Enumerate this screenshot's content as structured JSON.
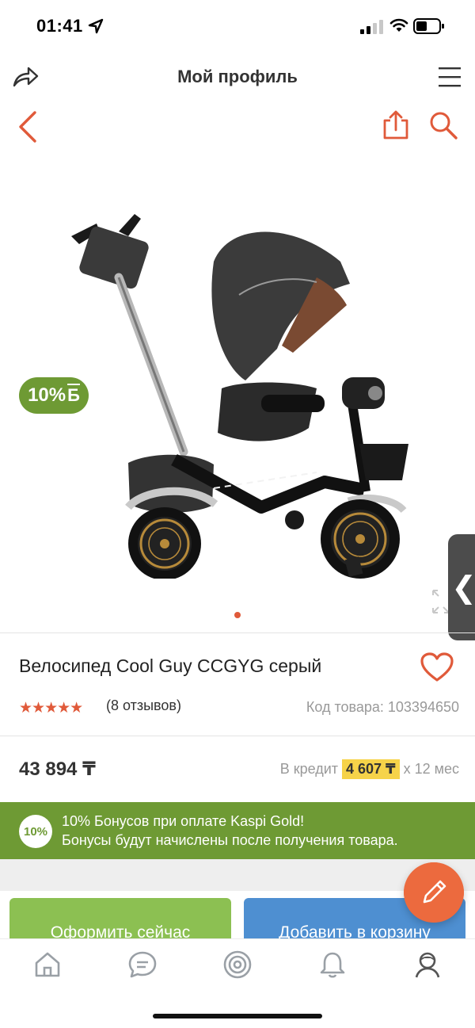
{
  "status_bar": {
    "time": "01:41"
  },
  "top_nav": {
    "title": "Мой профиль"
  },
  "gallery": {
    "bonus_badge_pct": "10%",
    "bonus_badge_symbol": "Б",
    "image_count_active": 1,
    "side_tab_glyph": "❮"
  },
  "product": {
    "title": "Велосипед Cool Guy CCGYG серый",
    "rating_stars": "★★★★★",
    "rating_value": 5,
    "reviews": "(8 отзывов)",
    "sku": "Код товара: 103394650",
    "price": "43 894 ₸",
    "credit_prefix": "В кредит",
    "credit_amount": "4 607 ₸",
    "credit_suffix": "х 12 мес"
  },
  "bonus_banner": {
    "badge": "10%",
    "line1": "10% Бонусов при оплате Kaspi Gold!",
    "line2": "Бонусы будут начислены после получения товара."
  },
  "actions": {
    "order_label": "Оформить сейчас",
    "cart_label": "Добавить в корзину"
  },
  "tab_bar": {
    "items": [
      "home-icon",
      "chat-icon",
      "target-icon",
      "bell-icon",
      "profile-icon"
    ],
    "active": "profile-icon"
  },
  "colors": {
    "accent": "#e05a3a",
    "bonus_green": "#6e9a34",
    "order_green": "#8cc052",
    "cart_blue": "#4e8fd1",
    "credit_yellow": "#f6d349",
    "fab_orange": "#ec6a3e"
  }
}
